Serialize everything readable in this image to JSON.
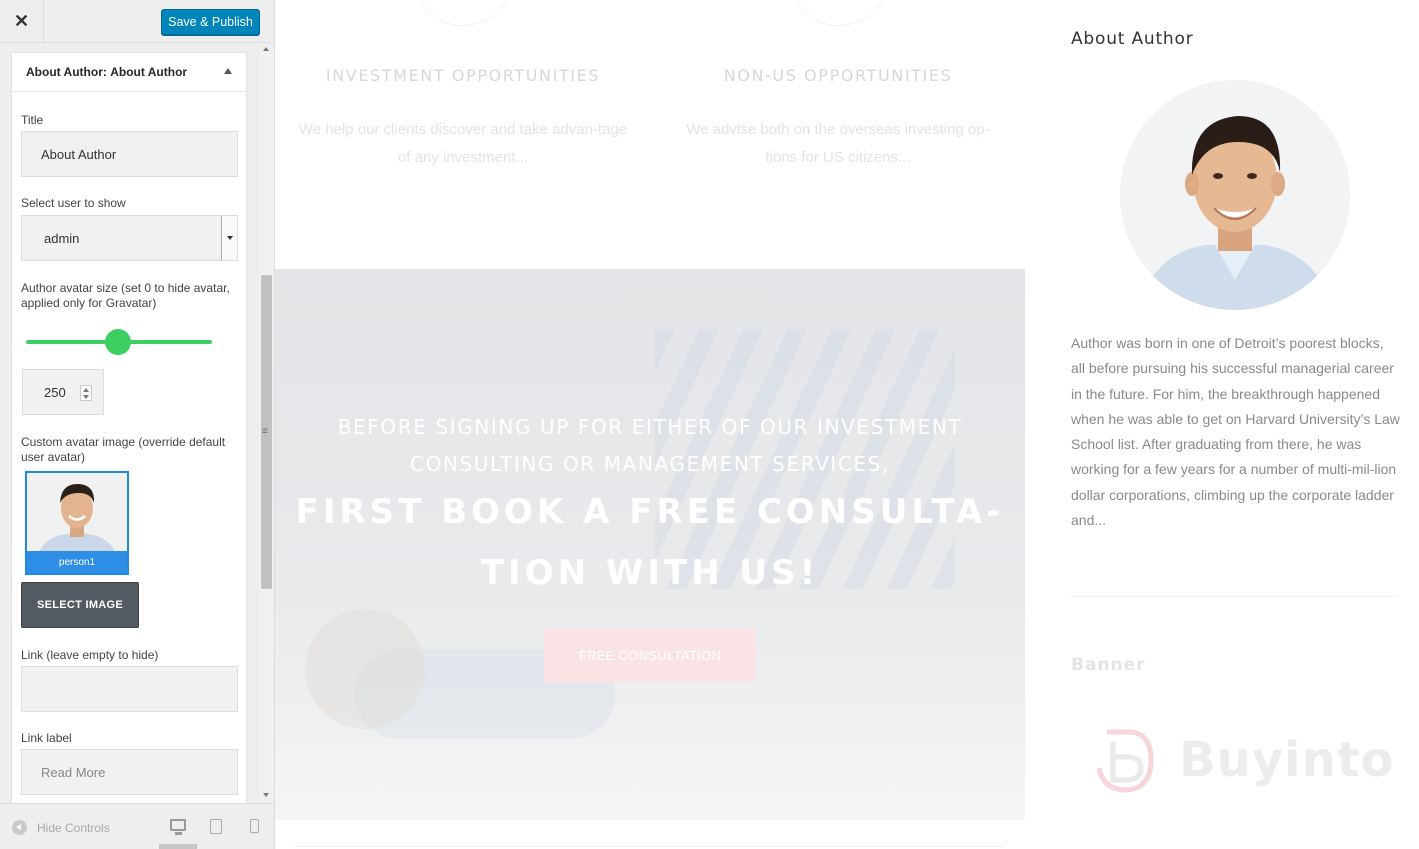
{
  "customizer": {
    "close_icon": "close-icon",
    "save_label": "Save & Publish",
    "section_prefix": "About Author: ",
    "section_name": "About Author",
    "fields": {
      "title_label": "Title",
      "title_value": "About Author",
      "user_label": "Select user to show",
      "user_value": "admin",
      "avatar_size_label": "Author avatar size (set 0 to hide avatar, applied only for Gravatar)",
      "avatar_size_value": "250",
      "avatar_slider_fraction": 0.5,
      "custom_avatar_label": "Custom avatar image (override default user avatar)",
      "custom_avatar_caption": "person1",
      "select_image_label": "SELECT IMAGE",
      "link_label": "Link (leave empty to hide)",
      "link_value": "",
      "link_text_label": "Link label",
      "link_text_placeholder": "Read More"
    },
    "footer": {
      "hide_controls": "Hide Controls",
      "devices": [
        "desktop-icon",
        "tablet-icon",
        "mobile-icon"
      ]
    }
  },
  "preview": {
    "services": [
      {
        "title": "INVESTMENT OPPORTUNITIES",
        "text": "We help our clients discover and take advan-tage of any investment..."
      },
      {
        "title": "NON-US OPPORTUNITIES",
        "text": "We advise both on the overseas investing op-tions for US citizens..."
      }
    ],
    "hero": {
      "subtitle": "BEFORE SIGNING UP FOR EITHER OF OUR INVESTMENT CONSULTING OR MANAGEMENT SERVICES,",
      "headline": "FIRST BOOK A FREE CONSULTA-TION WITH US!",
      "button": "FREE CONSULTATION"
    },
    "author_widget": {
      "title": "About Author",
      "bio": "Author was born in one of Detroit’s poorest blocks, all before pursuing his successful managerial career in the future. For him, the breakthrough happened when he was able to get on Harvard University’s Law School list. After graduating from there, he was working for a few years for a number of multi-mil-lion dollar corporations, climbing up the corporate ladder and..."
    },
    "banner_widget": {
      "title": "Banner",
      "logo_text": "Buyinto"
    }
  },
  "colors": {
    "primary_button": "#0085ba",
    "slider": "#3ecf62",
    "selected_image_border": "#1e8cd8",
    "hero_button": "#f9e3e5"
  }
}
